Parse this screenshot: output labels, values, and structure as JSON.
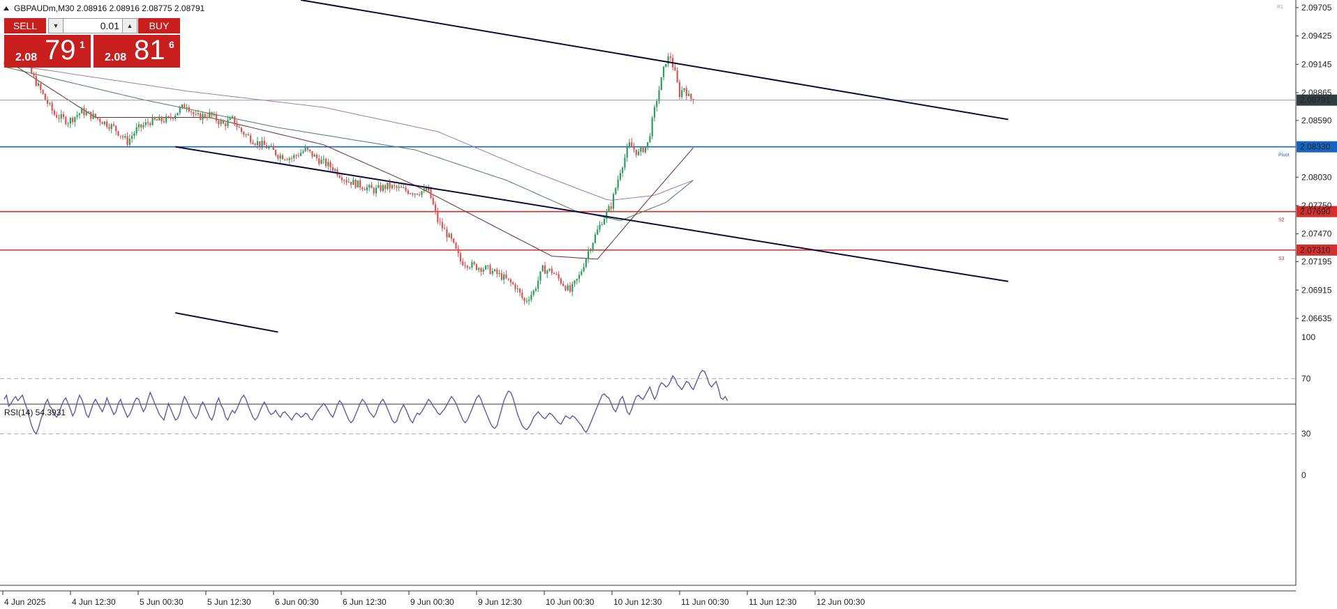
{
  "header": {
    "symbol_line": "GBPAUDm,M30  2.08916 2.08916 2.08775 2.08791"
  },
  "trade_panel": {
    "sell_label": "SELL",
    "buy_label": "BUY",
    "lot": "0.01",
    "sell_price_prefix": "2.08",
    "sell_price_main": "79",
    "sell_price_sup": "1",
    "buy_price_prefix": "2.08",
    "buy_price_main": "81",
    "buy_price_sup": "6"
  },
  "colors": {
    "bull": "#2e9b5a",
    "bear": "#e05050",
    "trendline": "#0a0a3c",
    "pivot": "#1565c0",
    "support": "#d32f2f",
    "ma_fast": "#6a2a2a",
    "ma_mid": "#4e7c5c",
    "ma_slow": "#a07ab0",
    "rsi": "#6655aa",
    "current_price_bg": "#2f3f3f"
  },
  "chart_data": [
    {
      "type": "candlestick",
      "symbol": "GBPAUDm",
      "timeframe": "M30",
      "open": 2.08916,
      "high": 2.08916,
      "low": 2.08775,
      "close": 2.08791,
      "y_ticks": [
        "2.09705",
        "2.09425",
        "2.09145",
        "2.08865",
        "2.08590",
        "2.08030",
        "2.07750",
        "2.07470",
        "2.07195",
        "2.06915",
        "2.06635"
      ],
      "ylim": [
        2.0649,
        2.0978
      ],
      "x_tick_labels": [
        "4 Jun 2025",
        "4 Jun 12:30",
        "5 Jun 00:30",
        "5 Jun 12:30",
        "6 Jun 00:30",
        "6 Jun 12:30",
        "9 Jun 00:30",
        "9 Jun 12:30",
        "10 Jun 00:30",
        "10 Jun 12:30",
        "11 Jun 00:30",
        "11 Jun 12:30",
        "12 Jun 00:30"
      ],
      "price_path": [
        [
          0,
          2.0915
        ],
        [
          8,
          2.0925
        ],
        [
          12,
          2.0905
        ],
        [
          18,
          2.088
        ],
        [
          22,
          2.0865
        ],
        [
          28,
          2.0858
        ],
        [
          34,
          2.0868
        ],
        [
          40,
          2.0862
        ],
        [
          48,
          2.0852
        ],
        [
          54,
          2.0838
        ],
        [
          58,
          2.085
        ],
        [
          64,
          2.0858
        ],
        [
          72,
          2.086
        ],
        [
          76,
          2.0868
        ],
        [
          80,
          2.0875
        ],
        [
          84,
          2.0862
        ],
        [
          90,
          2.0865
        ],
        [
          96,
          2.0855
        ],
        [
          100,
          2.086
        ],
        [
          104,
          2.0848
        ],
        [
          110,
          2.0838
        ],
        [
          116,
          2.0832
        ],
        [
          120,
          2.0825
        ],
        [
          126,
          2.0822
        ],
        [
          132,
          2.083
        ],
        [
          138,
          2.082
        ],
        [
          144,
          2.0812
        ],
        [
          150,
          2.08
        ],
        [
          156,
          2.0795
        ],
        [
          162,
          2.079
        ],
        [
          168,
          2.0794
        ],
        [
          172,
          2.0792
        ],
        [
          180,
          2.0788
        ],
        [
          186,
          2.079
        ],
        [
          190,
          2.076
        ],
        [
          196,
          2.074
        ],
        [
          200,
          2.072
        ],
        [
          206,
          2.0715
        ],
        [
          212,
          2.0712
        ],
        [
          218,
          2.0705
        ],
        [
          224,
          2.0695
        ],
        [
          228,
          2.068
        ],
        [
          232,
          2.069
        ],
        [
          236,
          2.0712
        ],
        [
          240,
          2.071
        ],
        [
          244,
          2.07
        ],
        [
          248,
          2.069
        ],
        [
          252,
          2.0705
        ],
        [
          256,
          2.073
        ],
        [
          262,
          2.076
        ],
        [
          266,
          2.0775
        ],
        [
          270,
          2.081
        ],
        [
          274,
          2.0835
        ],
        [
          278,
          2.0826
        ],
        [
          282,
          2.0836
        ],
        [
          286,
          2.088
        ],
        [
          290,
          2.0918
        ],
        [
          292,
          2.0922
        ],
        [
          294,
          2.0905
        ],
        [
          296,
          2.0885
        ],
        [
          298,
          2.0892
        ],
        [
          300,
          2.0882
        ],
        [
          302,
          2.0879
        ]
      ],
      "ma_fast_path": [
        [
          0,
          2.092
        ],
        [
          40,
          2.0862
        ],
        [
          90,
          2.0862
        ],
        [
          140,
          2.0835
        ],
        [
          180,
          2.0795
        ],
        [
          210,
          2.076
        ],
        [
          240,
          2.0725
        ],
        [
          260,
          2.0722
        ],
        [
          280,
          2.0775
        ],
        [
          302,
          2.0832
        ]
      ],
      "ma_mid_path": [
        [
          0,
          2.0912
        ],
        [
          60,
          2.088
        ],
        [
          120,
          2.0852
        ],
        [
          180,
          2.083
        ],
        [
          220,
          2.08
        ],
        [
          250,
          2.077
        ],
        [
          270,
          2.076
        ],
        [
          290,
          2.0778
        ],
        [
          302,
          2.08
        ]
      ],
      "ma_slow_path": [
        [
          0,
          2.0915
        ],
        [
          80,
          2.0888
        ],
        [
          140,
          2.0872
        ],
        [
          190,
          2.0848
        ],
        [
          230,
          2.081
        ],
        [
          265,
          2.078
        ],
        [
          285,
          2.0785
        ],
        [
          302,
          2.08
        ]
      ],
      "trendlines": [
        {
          "from": [
            130,
            2.0978
          ],
          "to": [
            440,
            2.086
          ]
        },
        {
          "from": [
            75,
            2.0833
          ],
          "to": [
            440,
            2.07
          ]
        },
        {
          "from": [
            75,
            2.0669
          ],
          "to": [
            120,
            2.065
          ]
        }
      ],
      "horizontal_levels": [
        {
          "label": "2.08330",
          "value": 2.0833,
          "tag": "Pivot",
          "color_key": "pivot"
        },
        {
          "label": "2.07690",
          "value": 2.0769,
          "tag": "S2",
          "color_key": "support"
        },
        {
          "label": "2.07310",
          "value": 2.0731,
          "tag": "S3",
          "color_key": "support"
        }
      ],
      "top_tag": "R1",
      "current_price": "2.08791",
      "current_price_value": 2.08791
    },
    {
      "type": "line",
      "title": "RSI(14) 54.3931",
      "y_ticks": [
        "100",
        "70",
        "30",
        "0"
      ],
      "ylim": [
        0,
        100
      ],
      "levels": [
        70,
        30
      ],
      "values": [
        55,
        58,
        50,
        52,
        55,
        57,
        54,
        56,
        58,
        53,
        48,
        42,
        36,
        32,
        30,
        34,
        40,
        45,
        52,
        55,
        50,
        48,
        44,
        42,
        45,
        50,
        54,
        56,
        52,
        48,
        43,
        46,
        53,
        58,
        55,
        50,
        44,
        42,
        47,
        52,
        55,
        52,
        49,
        46,
        50,
        56,
        52,
        48,
        44,
        46,
        52,
        55,
        50,
        46,
        42,
        44,
        48,
        53,
        56,
        55,
        50,
        46,
        49,
        55,
        60,
        56,
        52,
        48,
        44,
        42,
        40,
        46,
        52,
        48,
        44,
        40,
        41,
        45,
        52,
        57,
        54,
        50,
        46,
        43,
        41,
        44,
        50,
        53,
        50,
        46,
        42,
        40,
        44,
        52,
        56,
        51,
        48,
        42,
        40,
        44,
        47,
        45,
        48,
        52,
        56,
        58,
        55,
        50,
        46,
        42,
        40,
        42,
        46,
        50,
        53,
        50,
        46,
        44,
        45,
        47,
        44,
        42,
        45,
        46,
        44,
        42,
        40,
        43,
        45,
        44,
        42,
        43,
        45,
        44,
        41,
        40,
        43,
        46,
        48,
        50,
        52,
        50,
        47,
        44,
        42,
        46,
        51,
        54,
        52,
        48,
        44,
        40,
        38,
        40,
        44,
        48,
        52,
        55,
        53,
        50,
        46,
        44,
        42,
        45,
        50,
        53,
        55,
        52,
        48,
        44,
        40,
        38,
        39,
        44,
        48,
        51,
        48,
        44,
        40,
        38,
        42,
        45,
        44,
        46,
        49,
        52,
        55,
        53,
        50,
        48,
        45,
        44,
        46,
        48,
        51,
        54,
        57,
        55,
        52,
        48,
        44,
        40,
        38,
        40,
        44,
        48,
        52,
        56,
        58,
        55,
        50,
        46,
        42,
        38,
        35,
        34,
        36,
        42,
        48,
        54,
        58,
        61,
        60,
        56,
        50,
        44,
        40,
        36,
        34,
        33,
        35,
        38,
        42,
        44,
        46,
        44,
        42,
        41,
        43,
        45,
        44,
        42,
        40,
        38,
        37,
        40,
        43,
        42,
        41,
        43,
        42,
        40,
        38,
        36,
        33,
        31,
        34,
        38,
        42,
        46,
        50,
        54,
        58,
        59,
        57,
        56,
        52,
        48,
        46,
        50,
        55,
        57,
        52,
        46,
        44,
        48,
        53,
        57,
        58,
        56,
        55,
        58,
        61,
        64,
        59,
        55,
        58,
        64,
        67,
        66,
        64,
        65,
        68,
        72,
        70,
        66,
        64,
        62,
        65,
        68,
        67,
        64,
        62,
        66,
        70,
        74,
        76,
        75,
        71,
        66,
        64,
        66,
        68,
        63,
        56,
        55,
        57,
        54
      ]
    }
  ]
}
